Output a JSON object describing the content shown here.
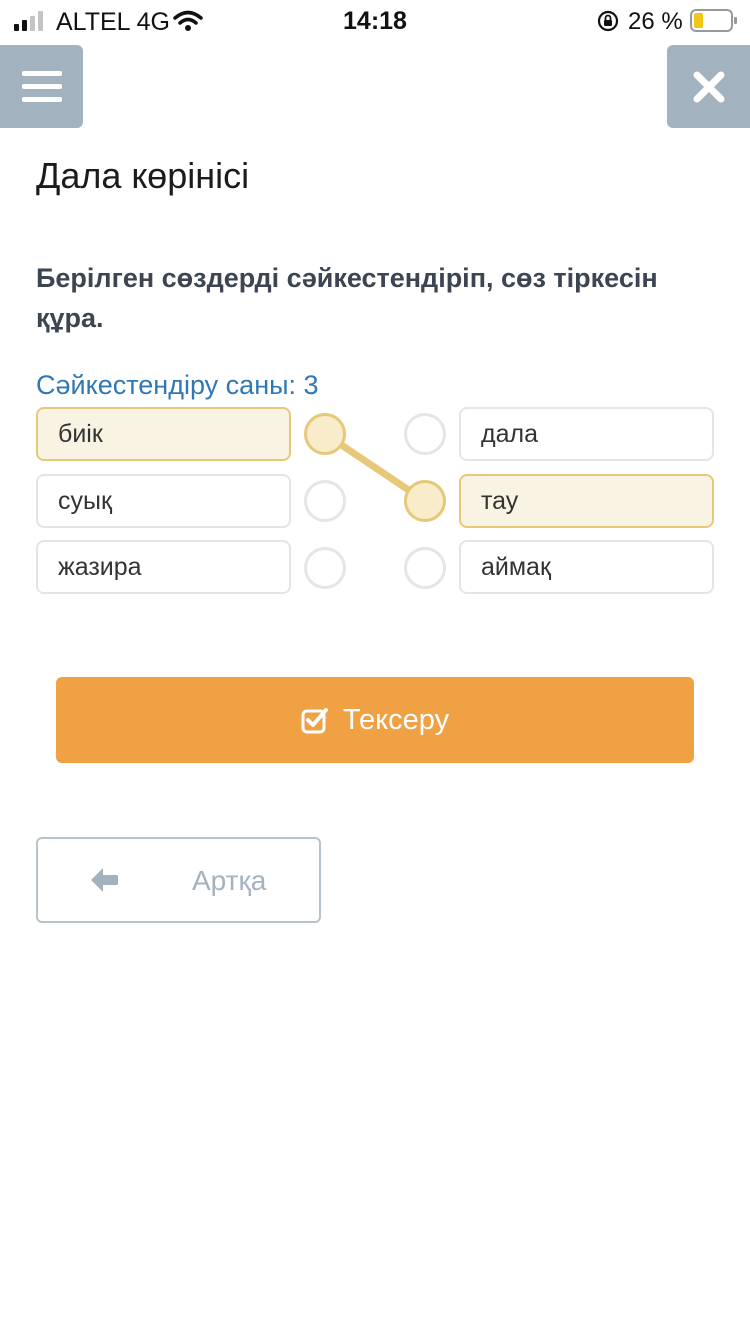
{
  "status_bar": {
    "carrier": "ALTEL 4G",
    "time": "14:18",
    "battery_percent": "26 %"
  },
  "header": {
    "menu_icon": "hamburger-menu-icon",
    "close_icon": "close-icon"
  },
  "page": {
    "title": "Дала көрінісі",
    "instruction": "Берілген сөздерді сәйкестендіріп, сөз тіркесін құра.",
    "match_count_label": "Сәйкестендіру саны: 3"
  },
  "matching": {
    "left_items": [
      {
        "label": "биік",
        "selected": true
      },
      {
        "label": "суық",
        "selected": false
      },
      {
        "label": "жазира",
        "selected": false
      }
    ],
    "right_items": [
      {
        "label": "дала",
        "selected": false
      },
      {
        "label": "тау",
        "selected": true
      },
      {
        "label": "аймақ",
        "selected": false
      }
    ],
    "connections": [
      {
        "from": "биік",
        "to": "тау"
      }
    ],
    "highlight_color": "#e6c878"
  },
  "actions": {
    "check_label": "Тексеру",
    "check_icon": "check-square-icon",
    "back_label": "Артқа",
    "back_icon": "arrow-left-icon",
    "accent_color": "#efa144"
  }
}
